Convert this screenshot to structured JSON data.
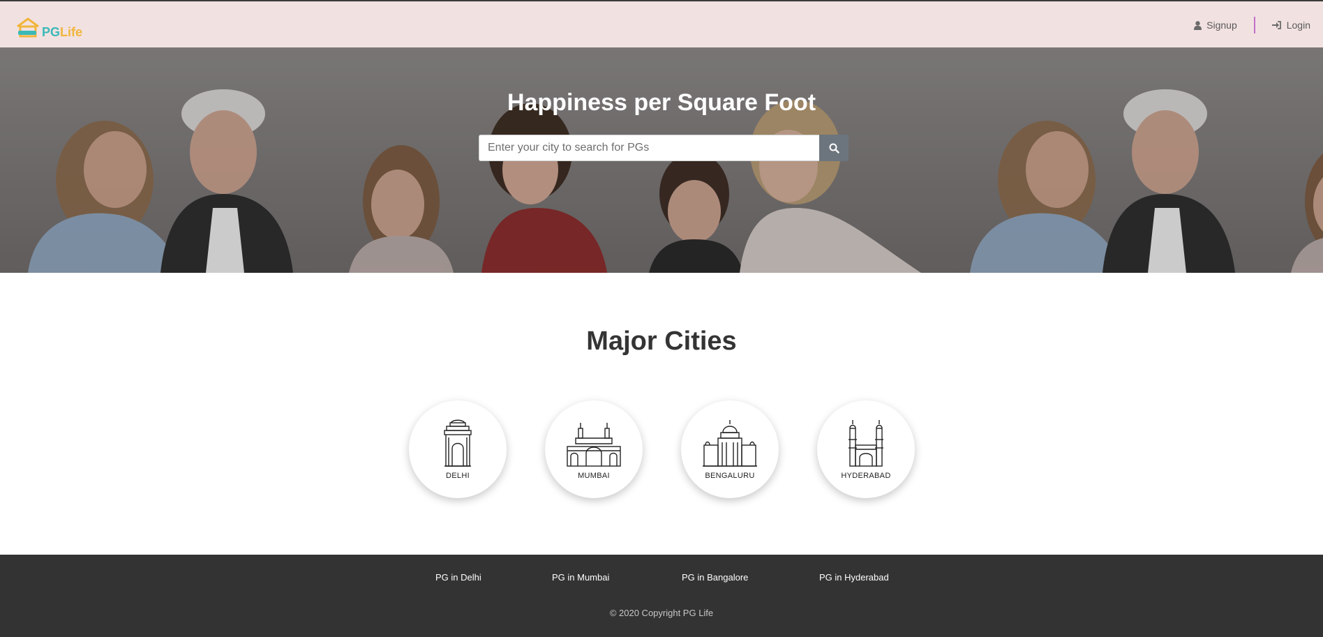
{
  "header": {
    "logo_pg": "PG",
    "logo_life": "Life",
    "signup_label": "Signup",
    "login_label": "Login",
    "icons": {
      "signup": "user-icon",
      "login": "sign-in-icon"
    }
  },
  "hero": {
    "title": "Happiness per Square Foot",
    "search_placeholder": "Enter your city to search for PGs",
    "search_value": "",
    "search_icon": "search-icon"
  },
  "cities": {
    "title": "Major Cities",
    "items": [
      {
        "label": "DELHI",
        "icon": "india-gate-icon"
      },
      {
        "label": "MUMBAI",
        "icon": "gateway-of-india-icon"
      },
      {
        "label": "BENGALURU",
        "icon": "vidhana-soudha-icon"
      },
      {
        "label": "HYDERABAD",
        "icon": "charminar-icon"
      }
    ]
  },
  "footer": {
    "links": [
      "PG in Delhi",
      "PG in Mumbai",
      "PG in Bangalore",
      "PG in Hyderabad"
    ],
    "copyright": "© 2020 Copyright PG Life"
  },
  "colors": {
    "header_bg": "#f2e1e1",
    "logo_teal": "#3bb9b7",
    "logo_yellow": "#f1b53a",
    "nav_separator": "#c070c8",
    "search_button": "#6c757d",
    "footer_bg": "#333333"
  }
}
